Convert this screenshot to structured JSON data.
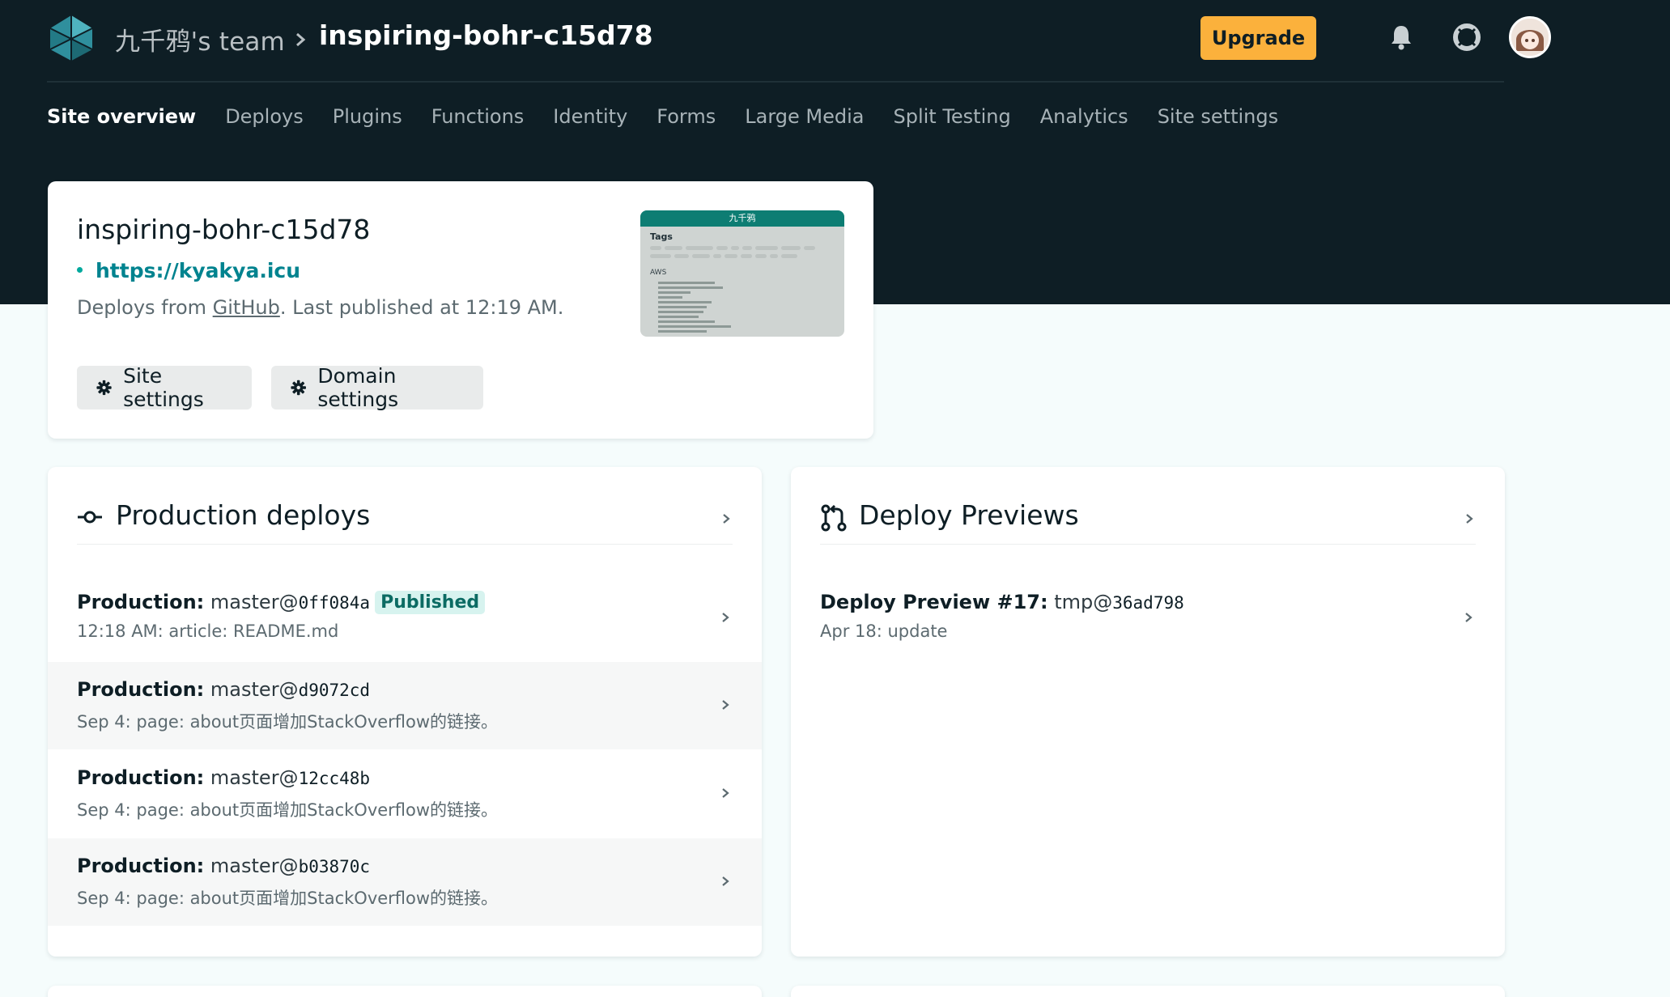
{
  "header": {
    "team": "九千鸦's team",
    "site": "inspiring-bohr-c15d78",
    "upgrade_label": "Upgrade"
  },
  "nav": [
    "Site overview",
    "Deploys",
    "Plugins",
    "Functions",
    "Identity",
    "Forms",
    "Large Media",
    "Split Testing",
    "Analytics",
    "Site settings"
  ],
  "site_card": {
    "title": "inspiring-bohr-c15d78",
    "url": "https://kyakya.icu",
    "desc_prefix": "Deploys from ",
    "desc_link": "GitHub",
    "desc_suffix": ". Last published at 12:19 AM.",
    "site_settings_label": "Site settings",
    "domain_settings_label": "Domain settings",
    "preview": {
      "bar_title": "九千鸦",
      "tags_heading": "Tags",
      "section_heading": "AWS"
    }
  },
  "production": {
    "title": "Production deploys",
    "deploys": [
      {
        "label": "Production:",
        "ref": "master@",
        "hash": "0ff084a",
        "badge": "Published",
        "subtitle": "12:18 AM: article: README.md"
      },
      {
        "label": "Production:",
        "ref": "master@",
        "hash": "d9072cd",
        "subtitle": "Sep 4: page: about页面增加StackOverflow的链接。"
      },
      {
        "label": "Production:",
        "ref": "master@",
        "hash": "12cc48b",
        "subtitle": "Sep 4: page: about页面增加StackOverflow的链接。"
      },
      {
        "label": "Production:",
        "ref": "master@",
        "hash": "b03870c",
        "subtitle": "Sep 4: page: about页面增加StackOverflow的链接。"
      }
    ]
  },
  "previews": {
    "title": "Deploy Previews",
    "items": [
      {
        "label": "Deploy Preview #17:",
        "ref": "tmp@",
        "hash": "36ad798",
        "subtitle": "Apr 18: update"
      }
    ]
  },
  "colors": {
    "header_bg": "#0e1e25",
    "accent": "#00838f",
    "upgrade": "#fbb13c",
    "badge_bg": "#d7f3ef"
  }
}
